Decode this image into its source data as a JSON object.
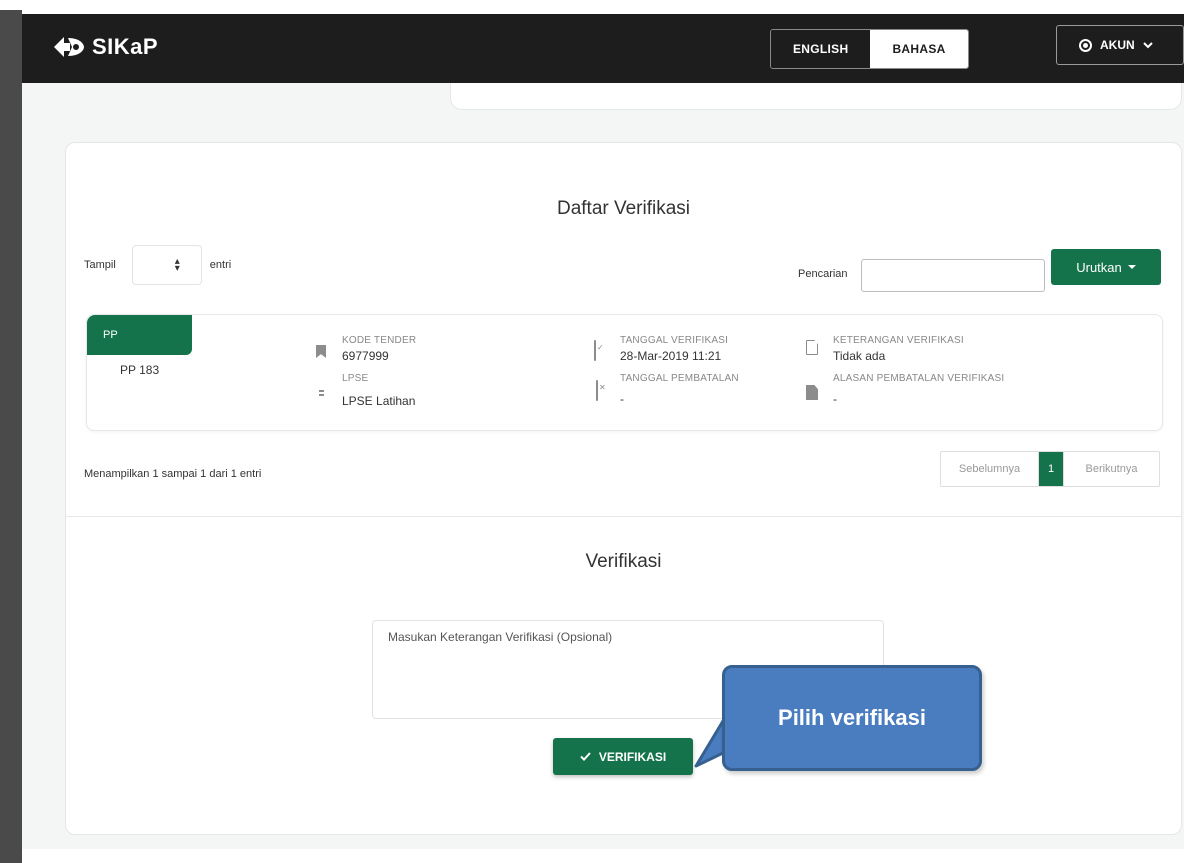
{
  "app": {
    "name": "SIKaP"
  },
  "nav": {
    "lang_english": "ENGLISH",
    "lang_bahasa": "BAHASA",
    "account_label": "AKUN"
  },
  "daftar": {
    "title": "Daftar Verifikasi",
    "show_label": "Tampil",
    "entries_label": "entri",
    "search_label": "Pencarian",
    "search_value": "",
    "sort_button": "Urutkan",
    "entry": {
      "tag": "PP",
      "subtitle": "PP 183",
      "kode_tender_label": "KODE TENDER",
      "kode_tender": "6977999",
      "lpse_label": "LPSE",
      "lpse": "LPSE Latihan",
      "tanggal_verifikasi_label": "TANGGAL VERIFIKASI",
      "tanggal_verifikasi": "28-Mar-2019 11:21",
      "tanggal_pembatalan_label": "TANGGAL PEMBATALAN",
      "tanggal_pembatalan": "-",
      "keterangan_label": "KETERANGAN VERIFIKASI",
      "keterangan": "Tidak ada",
      "alasan_label": "ALASAN PEMBATALAN VERIFIKASI",
      "alasan": "-"
    },
    "info": "Menampilkan 1 sampai 1 dari 1 entri",
    "pager": {
      "prev": "Sebelumnya",
      "current": "1",
      "next": "Berikutnya"
    }
  },
  "verifikasi": {
    "title": "Verifikasi",
    "placeholder": "Masukan Keterangan Verifikasi (Opsional)",
    "button": "VERIFIKASI"
  },
  "callout": {
    "text": "Pilih verifikasi"
  },
  "colors": {
    "accent": "#14734a",
    "navbar": "#1d1d1d",
    "callout": "#4a7cc0"
  }
}
